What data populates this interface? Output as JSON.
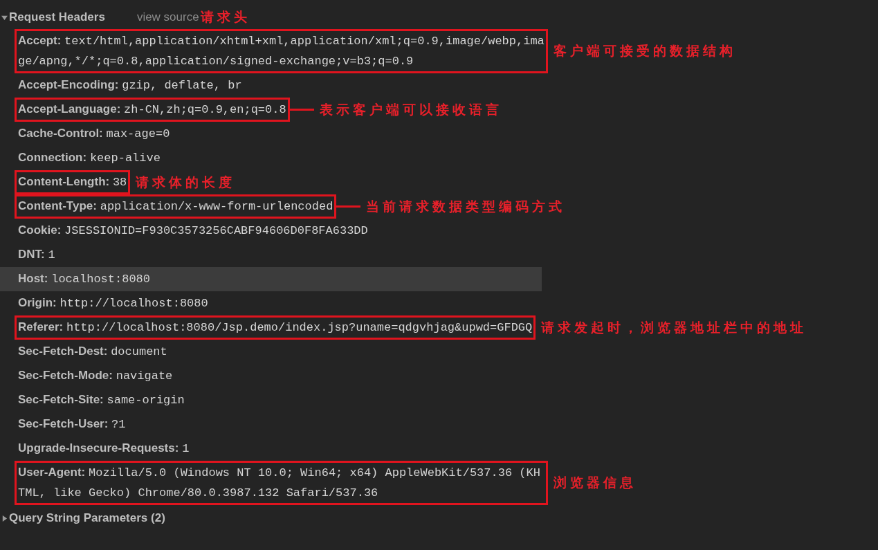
{
  "section": {
    "title": "Request Headers",
    "expanded": true,
    "view_source": "view source",
    "annotation": "请求头"
  },
  "headers": [
    {
      "name": "Accept:",
      "value": "text/html,application/xhtml+xml,application/xml;q=0.9,image/webp,image/apng,*/*;q=0.8,application/signed-exchange;v=b3;q=0.9",
      "boxed": true,
      "highlighted": false,
      "connector": false,
      "annotation": "客户端可接受的数据结构"
    },
    {
      "name": "Accept-Encoding:",
      "value": "gzip, deflate, br",
      "boxed": false,
      "highlighted": false,
      "connector": false
    },
    {
      "name": "Accept-Language:",
      "value": "zh-CN,zh;q=0.9,en;q=0.8",
      "boxed": true,
      "highlighted": false,
      "connector": true,
      "annotation": "表示客户端可以接收语言"
    },
    {
      "name": "Cache-Control:",
      "value": "max-age=0",
      "boxed": false,
      "highlighted": false,
      "connector": false
    },
    {
      "name": "Connection:",
      "value": "keep-alive",
      "boxed": false,
      "highlighted": false,
      "connector": false
    },
    {
      "name": "Content-Length:",
      "value": "38",
      "boxed": true,
      "highlighted": false,
      "connector": false,
      "annotation": "请求体的长度"
    },
    {
      "name": "Content-Type:",
      "value": "application/x-www-form-urlencoded",
      "boxed": true,
      "highlighted": false,
      "connector": true,
      "annotation": "当前请求数据类型编码方式"
    },
    {
      "name": "Cookie:",
      "value": "JSESSIONID=F930C3573256CABF94606D0F8FA633DD",
      "boxed": false,
      "highlighted": false,
      "connector": false
    },
    {
      "name": "DNT:",
      "value": "1",
      "boxed": false,
      "highlighted": false,
      "connector": false
    },
    {
      "name": "Host:",
      "value": "localhost:8080",
      "boxed": false,
      "highlighted": true,
      "connector": false
    },
    {
      "name": "Origin:",
      "value": "http://localhost:8080",
      "boxed": false,
      "highlighted": false,
      "connector": false
    },
    {
      "name": "Referer:",
      "value": "http://localhost:8080/Jsp.demo/index.jsp?uname=qdgvhjag&upwd=GFDGQ",
      "boxed": true,
      "highlighted": false,
      "connector": false,
      "annotation": "请求发起时，浏览器地址栏中的地址"
    },
    {
      "name": "Sec-Fetch-Dest:",
      "value": "document",
      "boxed": false,
      "highlighted": false,
      "connector": false
    },
    {
      "name": "Sec-Fetch-Mode:",
      "value": "navigate",
      "boxed": false,
      "highlighted": false,
      "connector": false
    },
    {
      "name": "Sec-Fetch-Site:",
      "value": "same-origin",
      "boxed": false,
      "highlighted": false,
      "connector": false
    },
    {
      "name": "Sec-Fetch-User:",
      "value": "?1",
      "boxed": false,
      "highlighted": false,
      "connector": false
    },
    {
      "name": "Upgrade-Insecure-Requests:",
      "value": "1",
      "boxed": false,
      "highlighted": false,
      "connector": false
    },
    {
      "name": "User-Agent:",
      "value": "Mozilla/5.0 (Windows NT 10.0; Win64; x64) AppleWebKit/537.36 (KHTML, like Gecko) Chrome/80.0.3987.132 Safari/537.36",
      "boxed": true,
      "highlighted": false,
      "connector": false,
      "annotation": "浏览器信息"
    }
  ],
  "next_section": {
    "title": "Query String Parameters (2)",
    "expanded": false
  }
}
